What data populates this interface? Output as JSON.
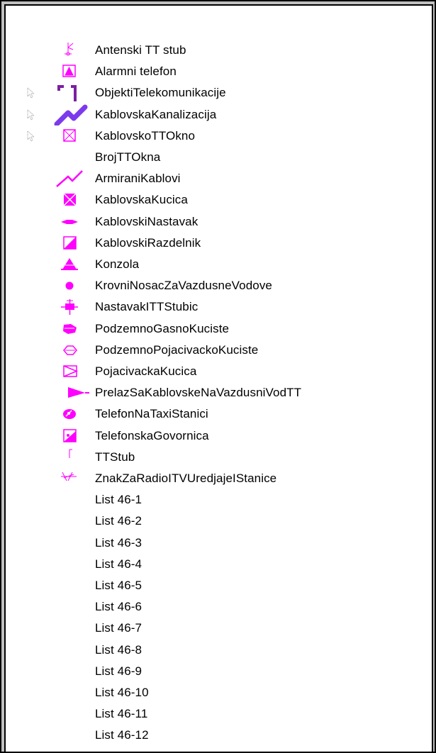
{
  "legend": {
    "items": [
      {
        "label": "Antenski TT stub",
        "icon": "antenna-pole-icon",
        "selectable": false
      },
      {
        "label": "Alarmni telefon",
        "icon": "alarm-phone-icon",
        "selectable": false
      },
      {
        "label": "ObjektiTelekomunikacije",
        "icon": "telecom-object-bracket-icon",
        "selectable": true
      },
      {
        "label": "KablovskaKanalizacija",
        "icon": "cable-duct-line-icon",
        "selectable": true
      },
      {
        "label": "KablovskoTTOkno",
        "icon": "cable-manhole-icon",
        "selectable": true
      },
      {
        "label": "BrojTTOkna",
        "icon": "",
        "selectable": false
      },
      {
        "label": "ArmiraniKablovi",
        "icon": "armored-cable-line-icon",
        "selectable": false
      },
      {
        "label": "KablovskaKucica",
        "icon": "cable-cabinet-icon",
        "selectable": false
      },
      {
        "label": "KablovskiNastavak",
        "icon": "cable-joint-icon",
        "selectable": false
      },
      {
        "label": "KablovskiRazdelnik",
        "icon": "cable-distributor-icon",
        "selectable": false
      },
      {
        "label": "Konzola",
        "icon": "console-triangle-icon",
        "selectable": false
      },
      {
        "label": "KrovniNosacZaVazdusneVodove",
        "icon": "roof-support-dot-icon",
        "selectable": false
      },
      {
        "label": "NastavakITTStubic",
        "icon": "extension-post-icon",
        "selectable": false
      },
      {
        "label": "PodzemnoGasnoKuciste",
        "icon": "underground-gas-housing-icon",
        "selectable": false
      },
      {
        "label": "PodzemnoPojacivackoKuciste",
        "icon": "underground-amplifier-housing-icon",
        "selectable": false
      },
      {
        "label": "PojacivackaKucica",
        "icon": "amplifier-box-icon",
        "selectable": false
      },
      {
        "label": "PrelazSaKablovskeNaVazdusniVodTT",
        "icon": "transition-flag-icon",
        "selectable": false
      },
      {
        "label": "TelefonNaTaxiStanici",
        "icon": "taxi-phone-icon",
        "selectable": false
      },
      {
        "label": "TelefonskaGovornica",
        "icon": "phone-booth-icon",
        "selectable": false
      },
      {
        "label": "TTStub",
        "icon": "tt-pole-icon",
        "selectable": false
      },
      {
        "label": "ZnakZaRadioITVUredjajeIStanice",
        "icon": "radio-tv-sign-icon",
        "selectable": false
      },
      {
        "label": "List 46-1",
        "icon": "",
        "selectable": false
      },
      {
        "label": "List 46-2",
        "icon": "",
        "selectable": false
      },
      {
        "label": "List 46-3",
        "icon": "",
        "selectable": false
      },
      {
        "label": "List 46-4",
        "icon": "",
        "selectable": false
      },
      {
        "label": "List 46-5",
        "icon": "",
        "selectable": false
      },
      {
        "label": "List 46-6",
        "icon": "",
        "selectable": false
      },
      {
        "label": "List 46-7",
        "icon": "",
        "selectable": false
      },
      {
        "label": "List 46-8",
        "icon": "",
        "selectable": false
      },
      {
        "label": "List 46-9",
        "icon": "",
        "selectable": false
      },
      {
        "label": "List 46-10",
        "icon": "",
        "selectable": false
      },
      {
        "label": "List 46-11",
        "icon": "",
        "selectable": false
      },
      {
        "label": "List 46-12",
        "icon": "",
        "selectable": false
      }
    ]
  },
  "colors": {
    "symbol_magenta": "#ff00ff",
    "symbol_purple": "#7b1fa2",
    "symbol_violet": "#7c3aed",
    "text": "#000000"
  }
}
